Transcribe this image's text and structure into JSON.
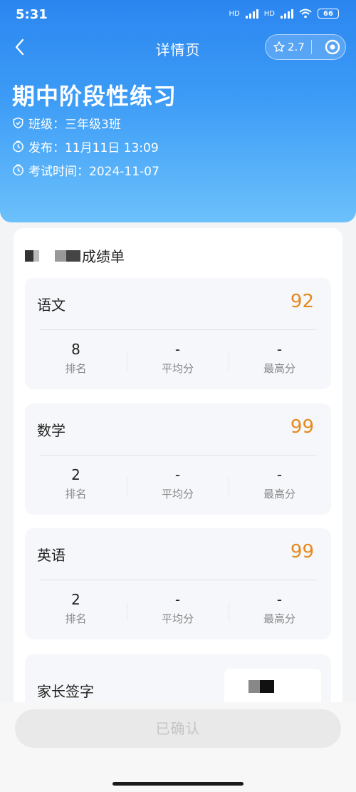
{
  "status_bar": {
    "time": "5:31",
    "network": "HD",
    "battery": "66"
  },
  "navbar": {
    "title": "详情页",
    "rating": "2.7",
    "icons": [
      "back-chevron-icon",
      "star-icon",
      "target-icon"
    ]
  },
  "exam": {
    "title": "期中阶段性练习",
    "class_text": "班级：三年级3班",
    "publish_text": "发布：11月11日 13:09",
    "exam_time_text": "考试时间：2024-11-07"
  },
  "report": {
    "title_suffix": "成绩单",
    "stat_labels": {
      "rank": "排名",
      "average": "平均分",
      "highest": "最高分"
    },
    "subjects": [
      {
        "name": "语文",
        "score": "92",
        "rank": "8",
        "average": "-",
        "highest": "-"
      },
      {
        "name": "数学",
        "score": "99",
        "rank": "2",
        "average": "-",
        "highest": "-"
      },
      {
        "name": "英语",
        "score": "99",
        "rank": "2",
        "average": "-",
        "highest": "-"
      }
    ]
  },
  "signature": {
    "label": "家长签字"
  },
  "confirm_button": {
    "label": "已确认"
  },
  "colors": {
    "header_gradient_top": "#2b86f0",
    "header_gradient_bottom": "#6cc1fb",
    "score": "#e58a1c"
  }
}
